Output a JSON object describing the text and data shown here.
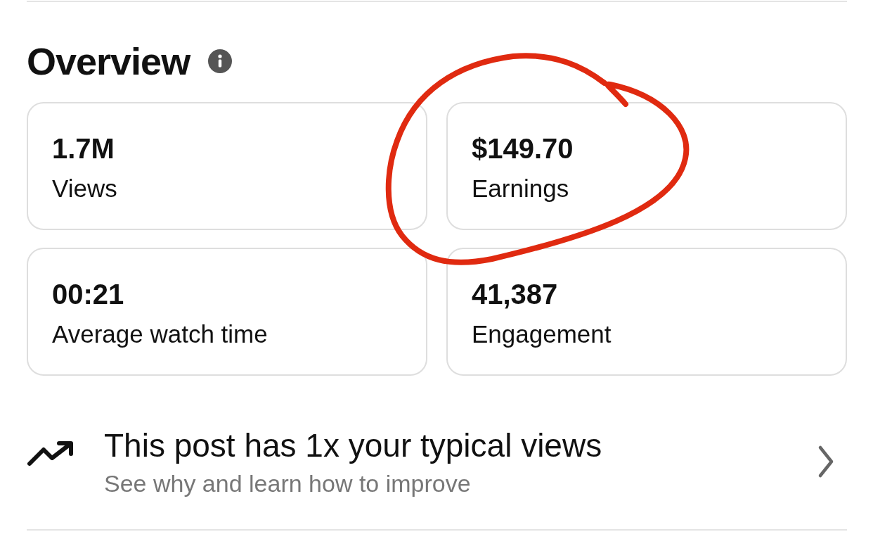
{
  "overview": {
    "title": "Overview"
  },
  "cards": [
    {
      "value": "1.7M",
      "label": "Views"
    },
    {
      "value": "$149.70",
      "label": "Earnings"
    },
    {
      "value": "00:21",
      "label": "Average watch time"
    },
    {
      "value": "41,387",
      "label": "Engagement"
    }
  ],
  "insight": {
    "title": "This post has 1x your typical views",
    "subtitle": "See why and learn how to improve"
  }
}
